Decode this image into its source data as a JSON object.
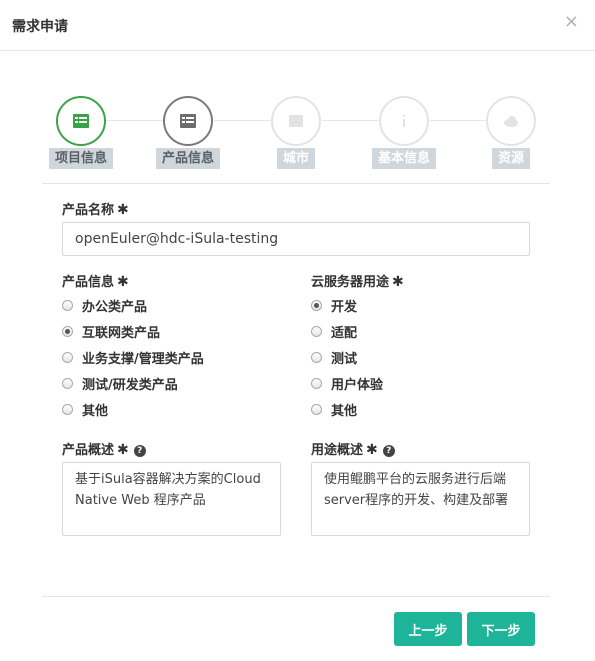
{
  "dialog": {
    "title": "需求申请",
    "close_symbol": "×"
  },
  "steps": [
    {
      "label": "项目信息",
      "status": "done",
      "icon": "list-icon"
    },
    {
      "label": "产品信息",
      "status": "current",
      "icon": "list-icon"
    },
    {
      "label": "城市",
      "status": "pending",
      "icon": "building-icon"
    },
    {
      "label": "基本信息",
      "status": "pending",
      "icon": "info-icon"
    },
    {
      "label": "资源",
      "status": "pending",
      "icon": "cloud-icon"
    }
  ],
  "colors": {
    "done": "#3aa347",
    "current": "#7a7a7a",
    "pending": "#e3e3e3",
    "button": "#1db49a"
  },
  "form": {
    "required_mark": "✱",
    "product_name": {
      "label": "产品名称",
      "value": "openEuler@hdc-iSula-testing"
    },
    "product_info": {
      "label": "产品信息",
      "options": [
        "办公类产品",
        "互联网类产品",
        "业务支撑/管理类产品",
        "测试/研发类产品",
        "其他"
      ],
      "selected": "互联网类产品"
    },
    "server_usage": {
      "label": "云服务器用途",
      "options": [
        "开发",
        "适配",
        "测试",
        "用户体验",
        "其他"
      ],
      "selected": "开发"
    },
    "product_summary": {
      "label": "产品概述",
      "value": "基于iSula容器解决方案的Cloud Native Web 程序产品"
    },
    "usage_summary": {
      "label": "用途概述",
      "value": "使用鲲鹏平台的云服务进行后端server程序的开发、构建及部署"
    }
  },
  "footer": {
    "prev_label": "上一步",
    "next_label": "下一步"
  }
}
